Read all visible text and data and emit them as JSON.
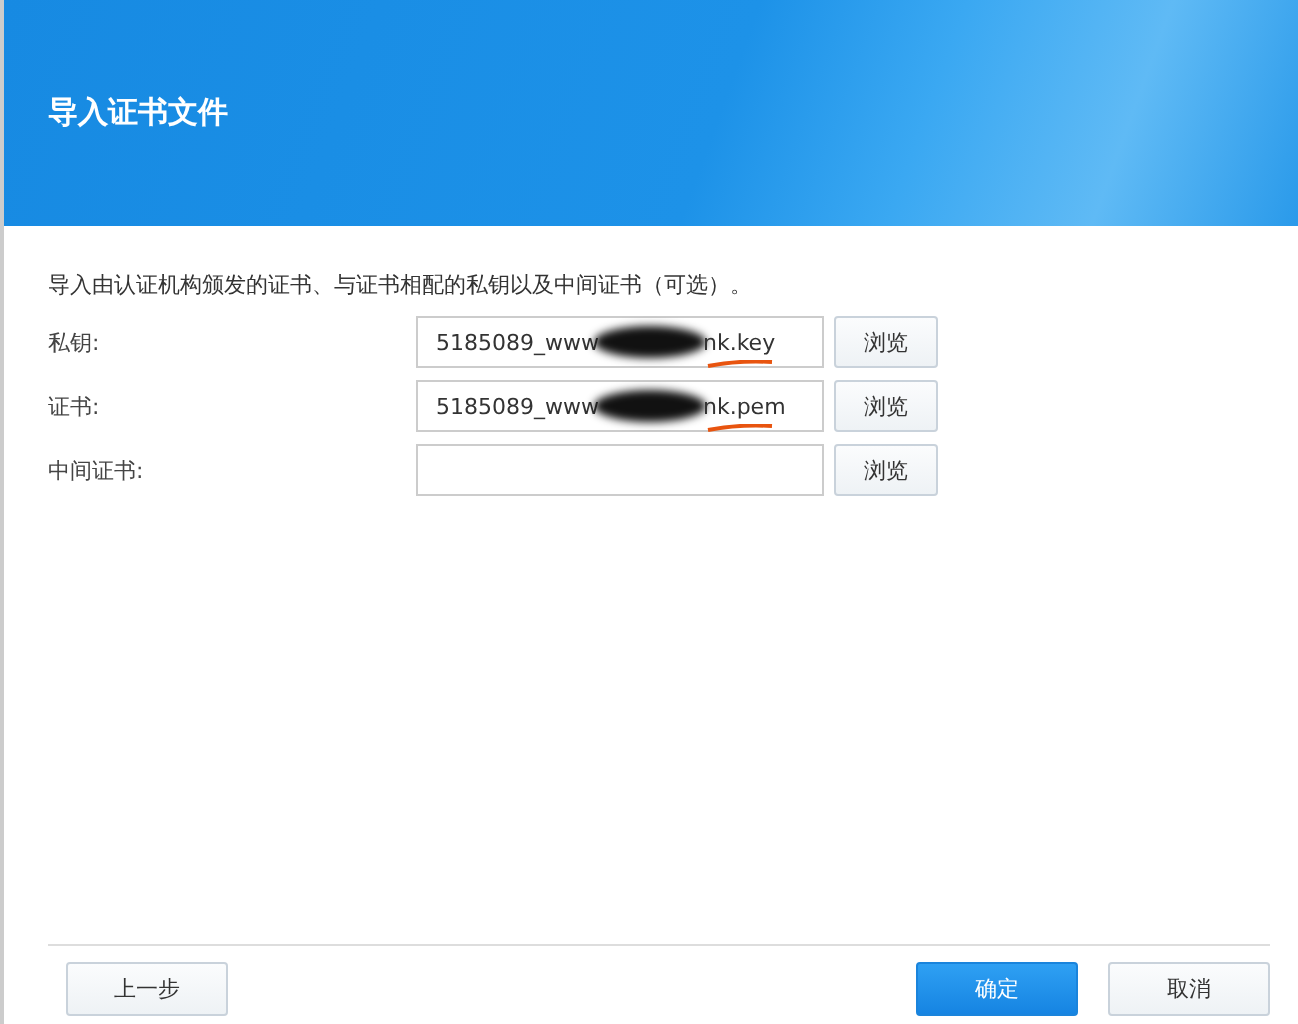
{
  "dialog": {
    "title": "导入证书文件"
  },
  "description": "导入由认证机构颁发的证书、与证书相配的私钥以及中间证书（可选）。",
  "fields": [
    {
      "label": "私钥:",
      "value_start": "5185089_www",
      "value_end": "nk.key",
      "redacted": true,
      "underlined": true,
      "button": "浏览"
    },
    {
      "label": "证书:",
      "value_start": "5185089_www",
      "value_end": "nk.pem",
      "redacted": true,
      "underlined": true,
      "button": "浏览"
    },
    {
      "label": "中间证书:",
      "button": "浏览"
    }
  ],
  "footer": {
    "back": "上一步",
    "buttons": [
      {
        "label": "确定",
        "primary": true
      },
      {
        "label": "取消",
        "primary": false
      }
    ]
  }
}
